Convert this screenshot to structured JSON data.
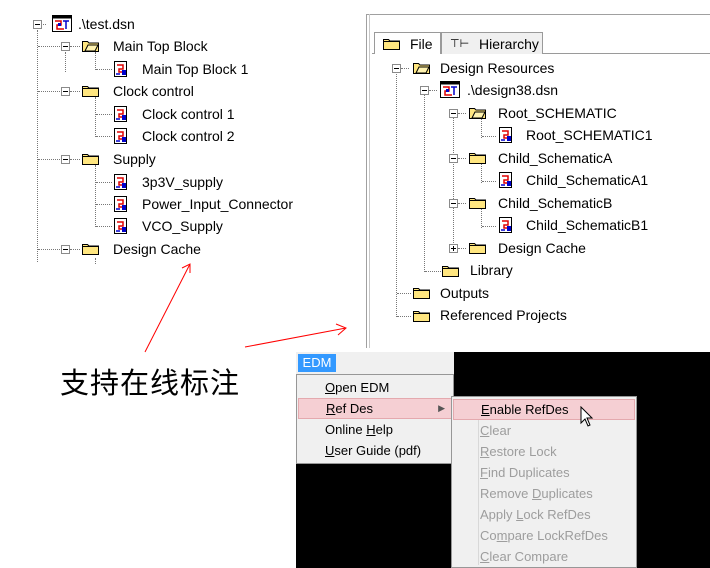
{
  "left_tree": {
    "root": ".\\test.dsn",
    "items": [
      {
        "label": "Main Top Block",
        "children": [
          "Main Top Block 1"
        ]
      },
      {
        "label": "Clock control",
        "children": [
          "Clock control 1",
          "Clock control 2"
        ]
      },
      {
        "label": "Supply",
        "children": [
          "3p3V_supply",
          "Power_Input_Connector",
          "VCO_Supply"
        ]
      },
      {
        "label": "Design Cache",
        "children": []
      }
    ]
  },
  "right_panel": {
    "tabs": [
      "File",
      "Hierarchy"
    ],
    "tree": {
      "root": "Design Resources",
      "dsn": ".\\design38.dsn",
      "root_schematic": "Root_SCHEMATIC",
      "root_schematic_page": "Root_SCHEMATIC1",
      "child_a": "Child_SchematicA",
      "child_a_page": "Child_SchematicA1",
      "child_b": "Child_SchematicB",
      "child_b_page": "Child_SchematicB1",
      "design_cache": "Design Cache",
      "library": "Library",
      "outputs": "Outputs",
      "referenced_projects": "Referenced Projects"
    }
  },
  "annotation": {
    "text": "支持在线标注",
    "color": "#ff0000"
  },
  "edm_menu": {
    "title": "EDM",
    "items": [
      "Open EDM",
      "Ref Des",
      "Online Help",
      "User Guide (pdf)"
    ],
    "submenu": [
      "Enable RefDes",
      "Clear",
      "Restore Lock",
      "Find Duplicates",
      "Remove Duplicates",
      "Apply Lock RefDes",
      "Compare LockRefDes",
      "Clear Compare"
    ]
  },
  "colors": {
    "highlight": "#f5cfd3",
    "menu_title_bg": "#3399ff",
    "folder": "#ffe680",
    "disabled_text": "#9d9d9d"
  }
}
